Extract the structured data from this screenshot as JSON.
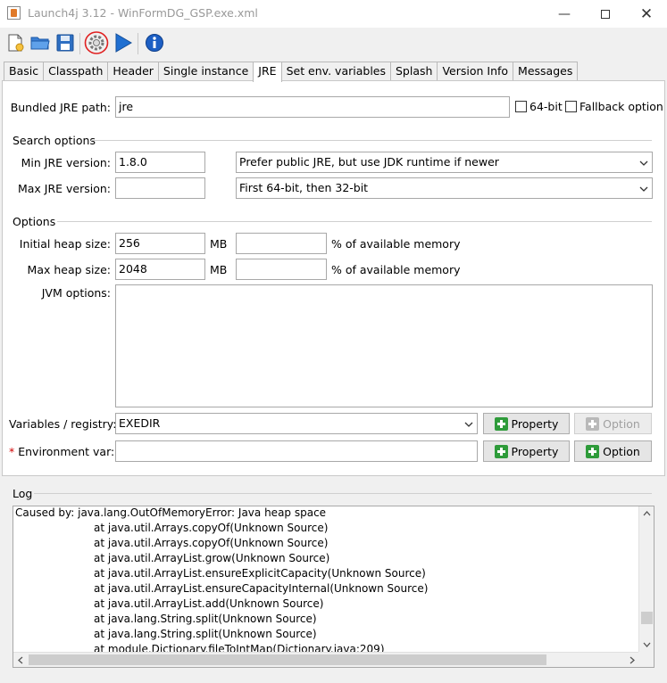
{
  "window": {
    "title": "Launch4j 3.12 - WinFormDG_GSP.exe.xml",
    "minimize_icon": "minimize-icon",
    "maximize_icon": "maximize-icon",
    "close_icon": "close-icon"
  },
  "toolbar": {
    "icons": [
      "new-file-icon",
      "open-folder-icon",
      "save-icon",
      "build-gear-icon",
      "run-play-icon",
      "about-info-icon"
    ],
    "annotation_color": "#e02020"
  },
  "tabs": [
    {
      "label": "Basic"
    },
    {
      "label": "Classpath"
    },
    {
      "label": "Header"
    },
    {
      "label": "Single instance"
    },
    {
      "label": "JRE",
      "active": true
    },
    {
      "label": "Set env. variables"
    },
    {
      "label": "Splash"
    },
    {
      "label": "Version Info"
    },
    {
      "label": "Messages"
    }
  ],
  "jre": {
    "bundled_path_label": "Bundled JRE path:",
    "bundled_path_value": "jre",
    "bit64_label": "64-bit",
    "bit64_checked": false,
    "fallback_label": "Fallback option",
    "fallback_checked": false
  },
  "search_options": {
    "section_label": "Search options",
    "min_label": "Min JRE version:",
    "min_value": "1.8.0",
    "max_label": "Max JRE version:",
    "max_value": "",
    "jdk_preference": "Prefer public JRE, but use JDK runtime if newer",
    "runtime_bits": "First 64-bit, then 32-bit"
  },
  "options": {
    "section_label": "Options",
    "initial_heap_label": "Initial heap size:",
    "initial_heap_value": "256",
    "initial_heap_unit": "MB",
    "initial_heap_percent": "",
    "max_heap_label": "Max heap size:",
    "max_heap_value": "2048",
    "max_heap_unit": "MB",
    "max_heap_percent": "",
    "percent_label": "% of available memory",
    "jvm_options_label": "JVM options:",
    "jvm_options_value": "",
    "variables_label": "Variables / registry:",
    "variables_value": "EXEDIR",
    "env_var_required": "*",
    "env_var_label": "Environment var:",
    "env_var_value": "",
    "property_label": "Property",
    "option_label": "Option"
  },
  "log": {
    "section_label": "Log",
    "lines": [
      "Caused by: java.lang.OutOfMemoryError: Java heap space",
      "at java.util.Arrays.copyOf(Unknown Source)",
      "at java.util.Arrays.copyOf(Unknown Source)",
      "at java.util.ArrayList.grow(Unknown Source)",
      "at java.util.ArrayList.ensureExplicitCapacity(Unknown Source)",
      "at java.util.ArrayList.ensureCapacityInternal(Unknown Source)",
      "at java.util.ArrayList.add(Unknown Source)",
      "at java.lang.String.split(Unknown Source)",
      "at java.lang.String.split(Unknown Source)",
      "at module.Dictionary.fileToIntMap(Dictionary.java:209)"
    ]
  }
}
